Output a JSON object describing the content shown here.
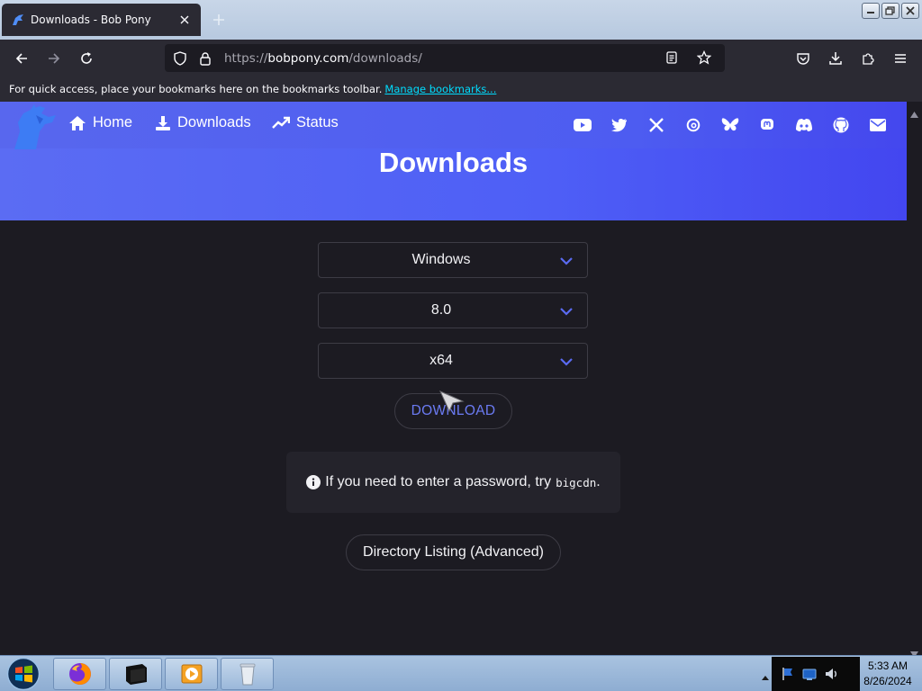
{
  "browser": {
    "tab_title": "Downloads - Bob Pony",
    "url_scheme": "https://",
    "url_host": "bobpony.com",
    "url_path": "/downloads/",
    "bookmarks_message": "For quick access, place your bookmarks here on the bookmarks toolbar.",
    "bookmarks_link": "Manage bookmarks..."
  },
  "site": {
    "nav": [
      {
        "label": "Home",
        "icon": "home-icon"
      },
      {
        "label": "Downloads",
        "icon": "download-icon"
      },
      {
        "label": "Status",
        "icon": "trend-icon"
      }
    ],
    "socials": [
      "youtube-icon",
      "twitter-icon",
      "x-icon",
      "threads-icon",
      "bluesky-icon",
      "mastodon-icon",
      "discord-icon",
      "github-icon",
      "email-icon"
    ],
    "accent": "#4f5ef2"
  },
  "page": {
    "title": "Downloads",
    "os_select": "Windows",
    "version_select": "8.0",
    "arch_select": "x64",
    "download_button": "DOWNLOAD",
    "note_text": "If you need to enter a password, try",
    "note_code": "bigcdn",
    "note_end": ".",
    "directory_button": "Directory Listing (Advanced)"
  },
  "taskbar": {
    "time": "5:33 AM",
    "date": "8/26/2024",
    "items": [
      "firefox-icon",
      "terminal-icon",
      "media-player-icon",
      "recycle-bin-icon"
    ]
  }
}
